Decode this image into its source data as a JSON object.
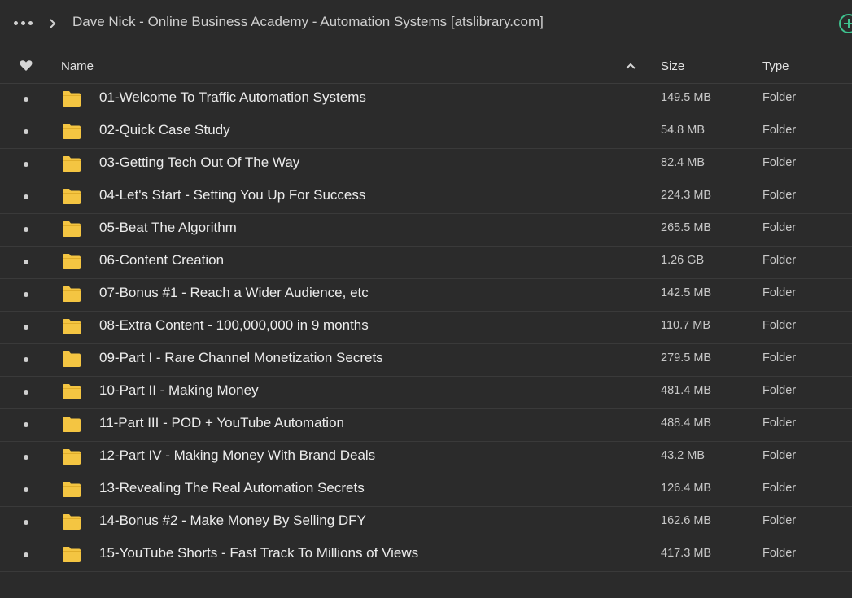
{
  "breadcrumb": {
    "current": "Dave Nick - Online Business Academy - Automation Systems [atslibrary.com]"
  },
  "columns": {
    "name": "Name",
    "size": "Size",
    "type": "Type"
  },
  "icons": {
    "more": "more-dots-icon",
    "chevron": "chevron-right-icon",
    "add": "add-circle-icon",
    "favorite": "heart-icon",
    "sort": "sort-ascending-icon",
    "folder": "folder-icon"
  },
  "colors": {
    "background": "#2b2b2b",
    "folder": "#f4c542",
    "accent": "#3ec28f"
  },
  "rows": [
    {
      "name": "01-Welcome To Traffic Automation Systems",
      "size": "149.5 MB",
      "type": "Folder"
    },
    {
      "name": "02-Quick Case Study",
      "size": "54.8 MB",
      "type": "Folder"
    },
    {
      "name": "03-Getting Tech Out Of The Way",
      "size": "82.4 MB",
      "type": "Folder"
    },
    {
      "name": "04-Let's Start - Setting You Up For Success",
      "size": "224.3 MB",
      "type": "Folder"
    },
    {
      "name": "05-Beat The Algorithm",
      "size": "265.5 MB",
      "type": "Folder"
    },
    {
      "name": "06-Content Creation",
      "size": "1.26 GB",
      "type": "Folder"
    },
    {
      "name": "07-Bonus #1 - Reach a Wider Audience, etc",
      "size": "142.5 MB",
      "type": "Folder"
    },
    {
      "name": "08-Extra Content - 100,000,000 in 9 months",
      "size": "110.7 MB",
      "type": "Folder"
    },
    {
      "name": "09-Part I - Rare Channel Monetization Secrets",
      "size": "279.5 MB",
      "type": "Folder"
    },
    {
      "name": "10-Part II - Making Money",
      "size": "481.4 MB",
      "type": "Folder"
    },
    {
      "name": "11-Part III - POD + YouTube Automation",
      "size": "488.4 MB",
      "type": "Folder"
    },
    {
      "name": "12-Part IV - Making Money With Brand Deals",
      "size": "43.2 MB",
      "type": "Folder"
    },
    {
      "name": "13-Revealing The Real Automation Secrets",
      "size": "126.4 MB",
      "type": "Folder"
    },
    {
      "name": "14-Bonus #2 - Make Money By Selling DFY",
      "size": "162.6 MB",
      "type": "Folder"
    },
    {
      "name": "15-YouTube Shorts - Fast Track To Millions of Views",
      "size": "417.3 MB",
      "type": "Folder"
    }
  ]
}
